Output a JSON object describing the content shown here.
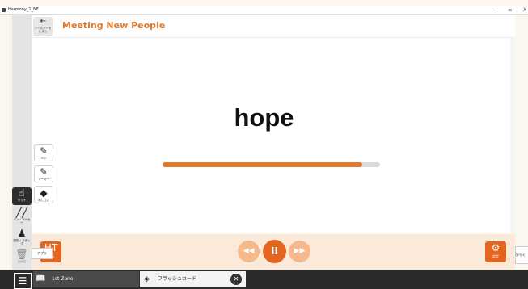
{
  "window": {
    "title": "Harmony_1_NE",
    "minimize": "–",
    "maximize": "▫",
    "close": "X"
  },
  "header": {
    "back_label": "ツールバーをしまう",
    "title": "Meeting New People"
  },
  "card": {
    "word": "hope",
    "progress": 0.92
  },
  "tools": [
    {
      "icon": "pen-icon",
      "glyph": "✎",
      "label": "ペン"
    },
    {
      "icon": "marker-icon",
      "glyph": "✎",
      "label": "マーカー"
    },
    {
      "icon": "eraser-icon",
      "glyph": "◆",
      "label": "消しゴム"
    }
  ],
  "rail": [
    {
      "icon": "hand-pointer-icon",
      "glyph": "☝",
      "label": "タッチ"
    },
    {
      "icon": "pen-marker-icon",
      "glyph": "╱╱",
      "label": "ペン・マーカー"
    },
    {
      "icon": "stamp-icon",
      "glyph": "♟",
      "label": "図形・スタンプ"
    },
    {
      "icon": "trash-icon",
      "glyph": "🗑",
      "label": "全消去"
    }
  ],
  "controls": {
    "left_button": "HT",
    "left_label": "表示",
    "settings_label": "設定",
    "prev": "◀◀",
    "pause": "II",
    "next": "▶▶",
    "app_chip": "アプリ",
    "right_chip": "ひらく"
  },
  "taskbar": {
    "menu": "☰",
    "tabs": [
      {
        "icon": "book-icon",
        "label": "1st Zone"
      },
      {
        "icon": "cube-icon",
        "label": "フラッシュカード"
      }
    ]
  },
  "colors": {
    "accent": "#e07a2c",
    "accent_dark": "#e3651f",
    "control_bg": "#fbe9da"
  }
}
